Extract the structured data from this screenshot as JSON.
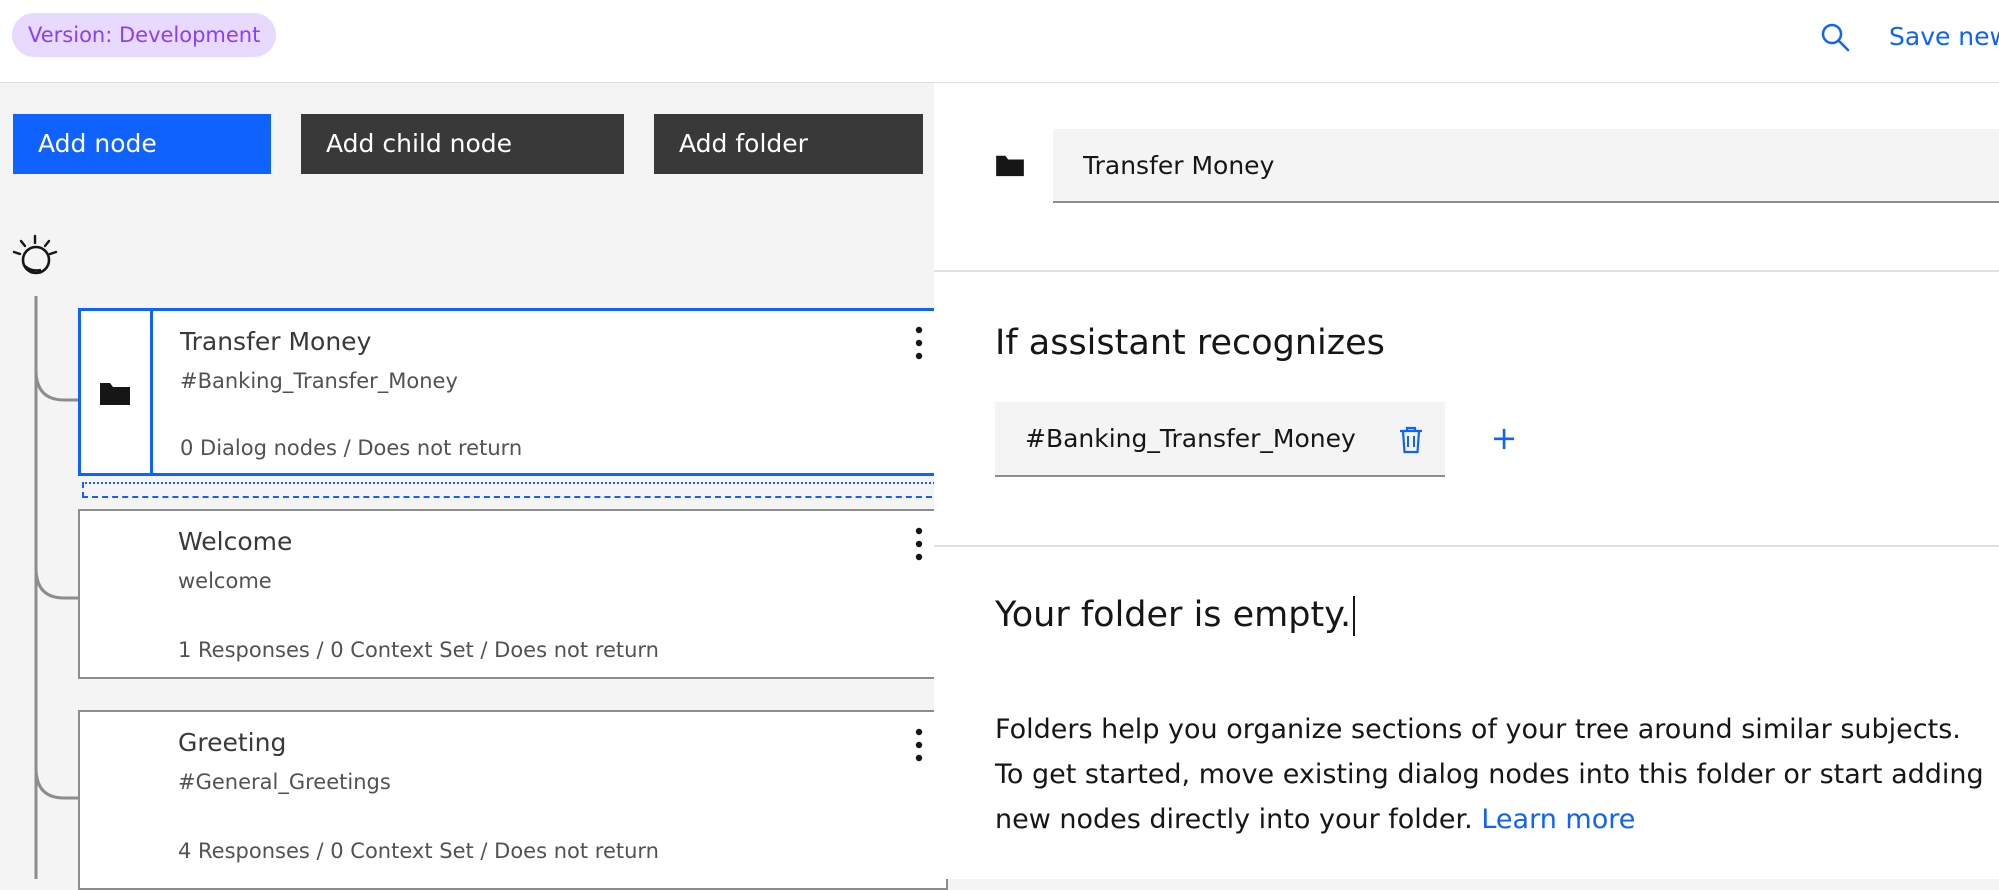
{
  "header": {
    "version_label": "Version: Development",
    "save_label": "Save new",
    "search_icon": "search-icon"
  },
  "toolbar": {
    "add_node": "Add node",
    "add_child_node": "Add child node",
    "add_folder": "Add folder"
  },
  "tree": {
    "root_icon": "watson-icon",
    "nodes": [
      {
        "title": "Transfer Money",
        "condition": "#Banking_Transfer_Money",
        "meta": "0 Dialog nodes / Does not return",
        "type": "folder",
        "selected": true
      },
      {
        "title": "Welcome",
        "condition": "welcome",
        "meta": "1 Responses / 0 Context Set / Does not return",
        "type": "node",
        "selected": false
      },
      {
        "title": "Greeting",
        "condition": "#General_Greetings",
        "meta": "4 Responses / 0 Context Set / Does not return",
        "type": "node",
        "selected": false
      }
    ]
  },
  "panel": {
    "folder_name": "Transfer Money",
    "condition_heading": "If assistant recognizes",
    "condition_value": "#Banking_Transfer_Money",
    "add_condition_label": "+",
    "empty_title": "Your folder is empty.",
    "empty_body": "Folders help you organize sections of your tree around similar subjects. To get started, move existing dialog nodes into this folder or start adding new nodes directly into your folder.",
    "learn_more": "Learn more"
  },
  "colors": {
    "accent": "#0f62fe",
    "dark_button": "#393939",
    "tag_bg": "#e8daff",
    "tag_text": "#8a3ffc"
  }
}
